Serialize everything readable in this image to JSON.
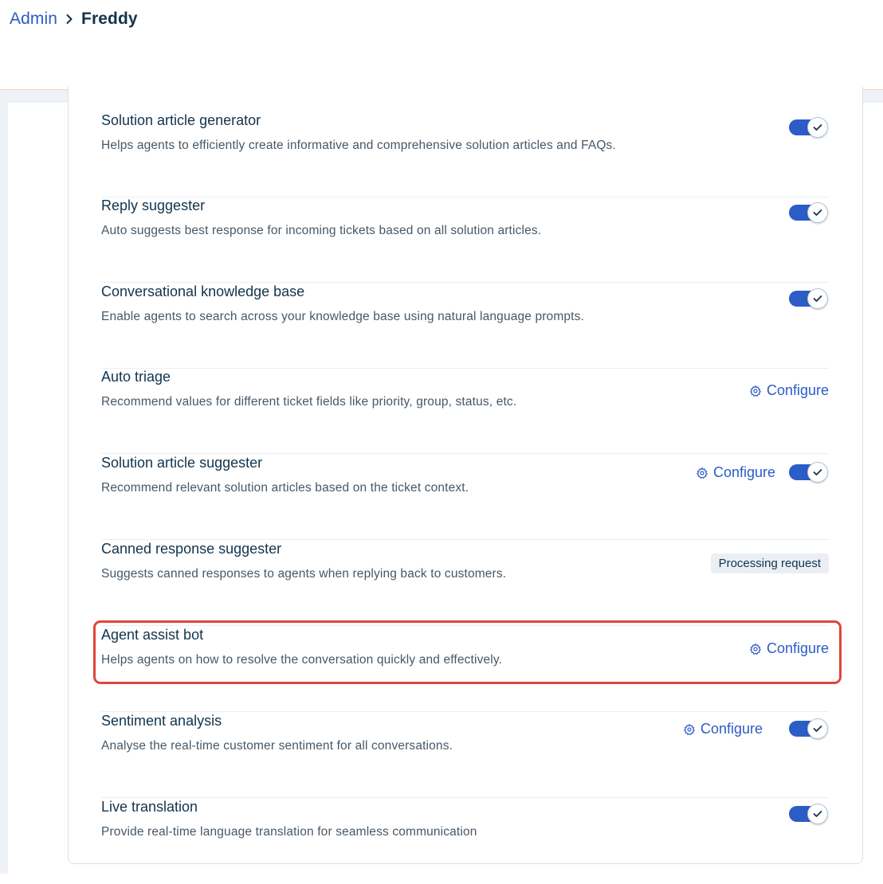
{
  "breadcrumb": {
    "root": "Admin",
    "current": "Freddy"
  },
  "features": [
    {
      "title": "Solution article generator",
      "description": "Helps agents to efficiently create informative and comprehensive solution articles and FAQs.",
      "toggle_on": true
    },
    {
      "title": "Reply suggester",
      "description": "Auto suggests best response for incoming tickets based on all solution articles.",
      "toggle_on": true
    },
    {
      "title": "Conversational knowledge base",
      "description": "Enable agents to search across your knowledge base using natural language prompts.",
      "toggle_on": true
    },
    {
      "title": "Auto triage",
      "description": "Recommend values for different ticket fields like priority, group, status, etc.",
      "configure_label": "Configure"
    },
    {
      "title": "Solution article suggester",
      "description": "Recommend relevant solution articles based on the ticket context.",
      "configure_label": "Configure",
      "toggle_on": true
    },
    {
      "title": "Canned response suggester",
      "description": "Suggests canned responses to agents when replying back to customers.",
      "status": "Processing request"
    },
    {
      "title": "Agent assist bot",
      "description": "Helps agents on how to resolve the conversation quickly and effectively.",
      "configure_label": "Configure",
      "highlighted": true
    },
    {
      "title": "Sentiment analysis",
      "description": "Analyse the real-time customer sentiment for all conversations.",
      "configure_label": "Configure",
      "toggle_on": true
    },
    {
      "title": "Live translation",
      "description": "Provide real-time language translation for seamless communication",
      "toggle_on": true
    }
  ],
  "colors": {
    "accent": "#2c5cc5",
    "highlight_border": "#e0463c",
    "text_primary": "#12344d",
    "text_secondary": "#475867"
  }
}
